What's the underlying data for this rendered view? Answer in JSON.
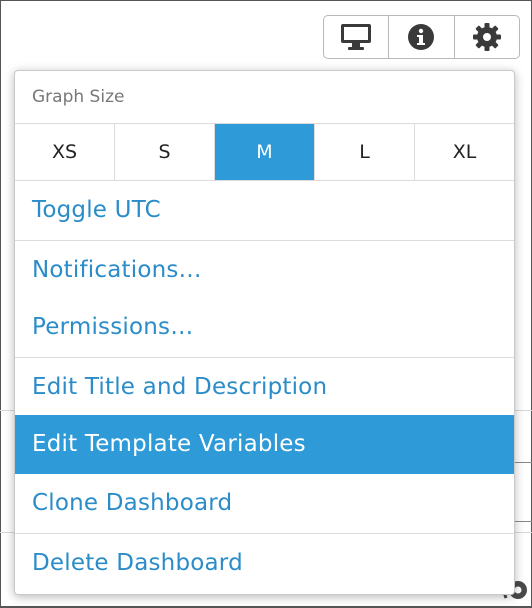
{
  "toolbar": {
    "buttons": [
      {
        "icon": "monitor-icon"
      },
      {
        "icon": "info-icon"
      },
      {
        "icon": "gear-icon"
      }
    ]
  },
  "menu": {
    "graph_size_label": "Graph Size",
    "sizes": [
      "XS",
      "S",
      "M",
      "L",
      "XL"
    ],
    "selected_size": "M",
    "items": [
      "Toggle UTC",
      "Notifications…",
      "Permissions…",
      "Edit Title and Description",
      "Edit Template Variables",
      "Clone Dashboard",
      "Delete Dashboard"
    ],
    "highlighted_item": "Edit Template Variables"
  },
  "colors": {
    "accent": "#2e9ad7",
    "link": "#2a8cc8",
    "icon": "#3a3a3a"
  }
}
